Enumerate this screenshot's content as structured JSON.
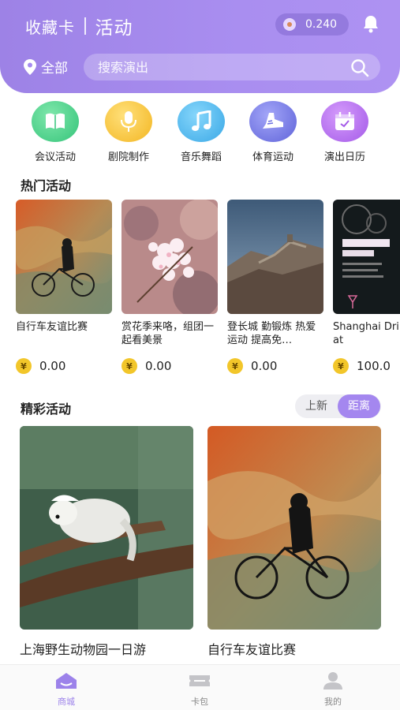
{
  "header": {
    "brand": "收藏卡",
    "title": "活动",
    "coin_balance": "0.240",
    "location": "全部",
    "search_placeholder": "搜索演出"
  },
  "categories": [
    {
      "label": "会议活动",
      "icon": "book-icon",
      "color": "#4fd08a"
    },
    {
      "label": "剧院制作",
      "icon": "microphone-icon",
      "color": "#f6c534"
    },
    {
      "label": "音乐舞蹈",
      "icon": "music-note-icon",
      "color": "#49b6ec"
    },
    {
      "label": "体育运动",
      "icon": "sneaker-icon",
      "color": "#7479e6"
    },
    {
      "label": "演出日历",
      "icon": "calendar-icon",
      "color": "#b26af0"
    }
  ],
  "hot": {
    "title": "热门活动",
    "items": [
      {
        "title": "自行车友谊比赛",
        "price": "0.00"
      },
      {
        "title": "赏花季来咯，组团一起看美景",
        "price": "0.00"
      },
      {
        "title": "登长城 勤锻炼 热爱运动 提高免…",
        "price": "0.00"
      },
      {
        "title": "Shanghai Drinks at",
        "price": "100.0"
      }
    ]
  },
  "featured": {
    "title": "精彩活动",
    "sort_options": [
      "上新",
      "距离"
    ],
    "active_sort": "距离",
    "items": [
      {
        "title": "上海野生动物园一日游"
      },
      {
        "title": "自行车友谊比赛"
      }
    ]
  },
  "tabbar": [
    {
      "label": "商城",
      "icon": "home-icon",
      "active": true
    },
    {
      "label": "卡包",
      "icon": "ticket-icon",
      "active": false
    },
    {
      "label": "我的",
      "icon": "user-icon",
      "active": false
    }
  ],
  "colors": {
    "accent": "#a487ef",
    "header_bg": "#a48af0",
    "coin_yellow": "#f2c62a"
  }
}
